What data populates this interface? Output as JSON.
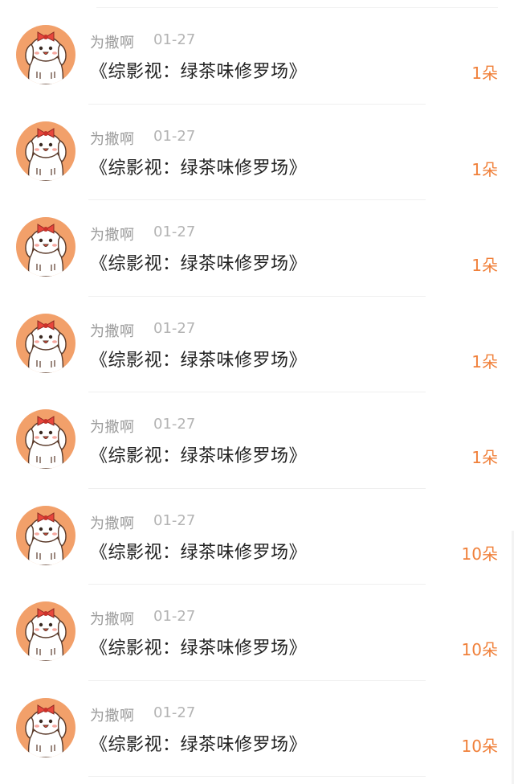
{
  "accent": "#f0803a",
  "avatar_icon": "puppy-avatar-icon",
  "items": [
    {
      "name": "为撒啊",
      "date": "01-27",
      "title": "《综影视：绿茶味修罗场》",
      "amount": "1朵"
    },
    {
      "name": "为撒啊",
      "date": "01-27",
      "title": "《综影视：绿茶味修罗场》",
      "amount": "1朵"
    },
    {
      "name": "为撒啊",
      "date": "01-27",
      "title": "《综影视：绿茶味修罗场》",
      "amount": "1朵"
    },
    {
      "name": "为撒啊",
      "date": "01-27",
      "title": "《综影视：绿茶味修罗场》",
      "amount": "1朵"
    },
    {
      "name": "为撒啊",
      "date": "01-27",
      "title": "《综影视：绿茶味修罗场》",
      "amount": "1朵"
    },
    {
      "name": "为撒啊",
      "date": "01-27",
      "title": "《综影视：绿茶味修罗场》",
      "amount": "10朵"
    },
    {
      "name": "为撒啊",
      "date": "01-27",
      "title": "《综影视：绿茶味修罗场》",
      "amount": "10朵"
    },
    {
      "name": "为撒啊",
      "date": "01-27",
      "title": "《综影视：绿茶味修罗场》",
      "amount": "10朵"
    }
  ]
}
